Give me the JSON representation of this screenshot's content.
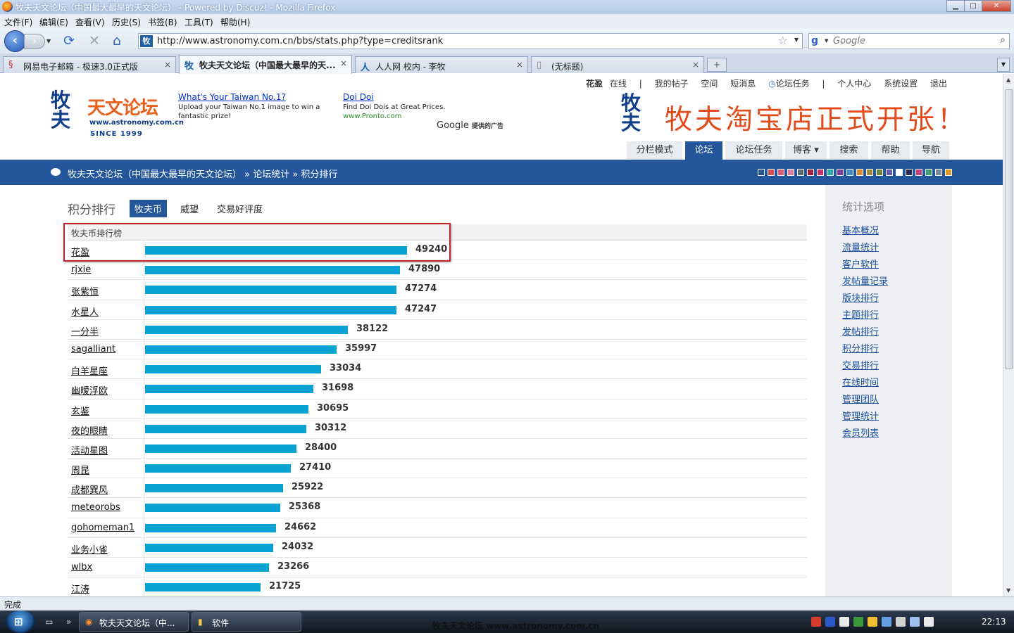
{
  "window": {
    "title": "牧夫天文论坛（中国最大最早的天文论坛） - Powered by Discuz! - Mozilla Firefox",
    "buttons": {
      "minimize": "▁",
      "maximize": "□",
      "close": "✕"
    }
  },
  "menu": [
    "文件(F)",
    "编辑(E)",
    "查看(V)",
    "历史(S)",
    "书签(B)",
    "工具(T)",
    "帮助(H)"
  ],
  "nav": {
    "back": "‹",
    "forward": "›",
    "reload": "⟳",
    "stop": "✕",
    "home": "⌂",
    "url": "http://www.astronomy.com.cn/bbs/stats.php?type=creditsrank",
    "search_placeholder": "Google",
    "search_engine": "g"
  },
  "tabs": [
    {
      "label": "网易电子邮箱 - 极速3.0正式版",
      "icon": "§",
      "active": false
    },
    {
      "label": "牧夫天文论坛（中国最大最早的天...",
      "icon": "牧",
      "active": true
    },
    {
      "label": "人人网 校内 - 李牧",
      "icon": "人",
      "active": false
    },
    {
      "label": "(无标题)",
      "icon": "▯",
      "active": false
    }
  ],
  "tab_close": "×",
  "newtab": "+",
  "header": {
    "username": "花盈",
    "userlinks": [
      "在线",
      "|",
      "我的帖子",
      "空间",
      "短消息",
      "论坛任务",
      "|",
      "个人中心",
      "系统设置",
      "退出"
    ],
    "logo_mark": "牧夫",
    "logo_name": "天文论坛",
    "logo_url": "www.astronomy.com.cn",
    "logo_since": "SINCE 1999",
    "ad1": {
      "title": "What's Your Taiwan No.1?",
      "text": "Upload your Taiwan No.1 image to win a fantastic prize!"
    },
    "ad2": {
      "title": "Doi Doi",
      "text": "Find Doi Dois at Great Prices.",
      "url": "www.Pronto.com"
    },
    "google_ads": "Google",
    "google_ads_suffix": "提供的广告",
    "banner_mark": "牧夫",
    "banner_text": "牧夫淘宝店正式开张！"
  },
  "mainnav": [
    {
      "label": "分栏模式",
      "active": false
    },
    {
      "label": "论坛",
      "active": true
    },
    {
      "label": "论坛任务",
      "active": false
    },
    {
      "label": "博客 ▾",
      "active": false
    },
    {
      "label": "搜索",
      "active": false
    },
    {
      "label": "帮助",
      "active": false
    },
    {
      "label": "导航",
      "active": false
    }
  ],
  "breadcrumb": "牧夫天文论坛（中国最大最早的天文论坛） » 论坛统计 » 积分排行",
  "swatch_colors": [
    "#23569a",
    "#d94b56",
    "#e05a7a",
    "#e07aa0",
    "#5a6a7a",
    "#a0203a",
    "#cc2f6e",
    "#2aa7a7",
    "#7a3fa0",
    "#3a8fd0",
    "#e08a30",
    "#a88b3a",
    "#6a8a3a",
    "#6a5ab0",
    "#ffffff",
    "#2a2a5a",
    "#c04080",
    "#3aa070",
    "#7a8a9a",
    "#e09a20"
  ],
  "page": {
    "title": "积分排行",
    "tabs": [
      {
        "label": "牧夫币",
        "active": true
      },
      {
        "label": "威望",
        "active": false
      },
      {
        "label": "交易好评度",
        "active": false
      }
    ]
  },
  "ranking": {
    "header": "牧夫币排行榜",
    "max_value": 49240,
    "rows": [
      {
        "name": "花盈",
        "value": 49240
      },
      {
        "name": "rjxie",
        "value": 47890
      },
      {
        "name": "张紫恒",
        "value": 47274
      },
      {
        "name": "水星人",
        "value": 47247
      },
      {
        "name": "一分半",
        "value": 38122
      },
      {
        "name": "sagalliant",
        "value": 35997
      },
      {
        "name": "白羊星座",
        "value": 33034
      },
      {
        "name": "幽暧浮欧",
        "value": 31698
      },
      {
        "name": "玄鉴",
        "value": 30695
      },
      {
        "name": "夜的眼睛",
        "value": 30312
      },
      {
        "name": "活动星图",
        "value": 28400
      },
      {
        "name": "周昆",
        "value": 27410
      },
      {
        "name": "成都巽风",
        "value": 25922
      },
      {
        "name": "meteorobs",
        "value": 25368
      },
      {
        "name": "gohomeman1",
        "value": 24662
      },
      {
        "name": "业务小雀",
        "value": 24032
      },
      {
        "name": "wlbx",
        "value": 23266
      },
      {
        "name": "江涛",
        "value": 21725
      }
    ]
  },
  "sidebar": {
    "title": "统计选项",
    "links": [
      "基本概况",
      "流量统计",
      "客户软件",
      "发帖量记录",
      "版块排行",
      "主题排行",
      "发帖排行",
      "积分排行",
      "交易排行",
      "在线时间",
      "管理团队",
      "管理统计",
      "会员列表"
    ]
  },
  "status": "完成",
  "taskbar": {
    "items": [
      {
        "label": "牧夫天文论坛（中...",
        "icon": "◉"
      },
      {
        "label": "软件",
        "icon": "▮"
      }
    ],
    "brand": "牧夫天文论坛 www.astronomy.com.cn",
    "clock": "22:13",
    "tray_colors": [
      "#d63b2b",
      "#2a5bc9",
      "#e8e8e8",
      "#3c9a3c",
      "#f0c030",
      "#66a0e0",
      "#d0d0d0",
      "#a0c0f0",
      "#e8e8e8"
    ]
  }
}
